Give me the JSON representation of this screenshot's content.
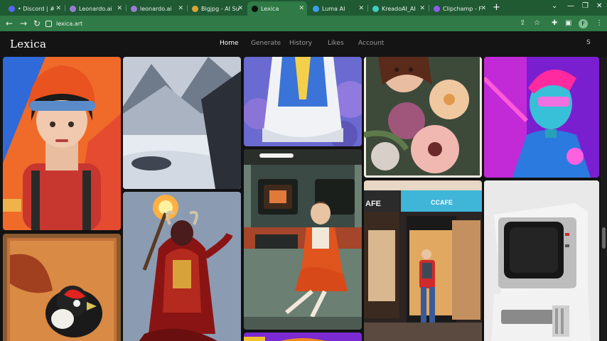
{
  "browser": {
    "tabs": [
      {
        "title": "• Discord | #",
        "favicon_color": "#5865f2"
      },
      {
        "title": "Leonardo.ai",
        "favicon_color": "#9b7bd6"
      },
      {
        "title": "leonardo.ai",
        "favicon_color": "#9b7bd6"
      },
      {
        "title": "Bigjpg - AI Su",
        "favicon_color": "#d8a53a"
      },
      {
        "title": "Lexica",
        "favicon_color": "#111111"
      },
      {
        "title": "Luma AI",
        "favicon_color": "#3aa0e8"
      },
      {
        "title": "KreadoAI_AI",
        "favicon_color": "#3fd0c0"
      },
      {
        "title": "Clipchamp - F",
        "favicon_color": "#8e5cf0"
      }
    ],
    "active_tab": 4,
    "new_tab_label": "+",
    "url": "lexica.art",
    "profile_initial": "F",
    "icons": [
      "back-icon",
      "forward-icon",
      "reload-icon",
      "share-icon",
      "star-icon",
      "extensions-icon",
      "sidebar-icon",
      "menu-icon"
    ],
    "window_controls": [
      "minimize-icon",
      "maximize-icon",
      "close-icon",
      "tab-search-icon"
    ]
  },
  "site": {
    "logo": "Lexica",
    "nav": [
      {
        "label": "Home",
        "active": true
      },
      {
        "label": "Generate",
        "active": false
      },
      {
        "label": "History",
        "active": false
      },
      {
        "label": "Likes",
        "active": false
      },
      {
        "label": "Account",
        "active": false
      }
    ],
    "user_initial": "S"
  },
  "gallery": {
    "images": [
      {
        "name": "firefighter-girl-helmet"
      },
      {
        "name": "snowy-mountain-landscape"
      },
      {
        "name": "princess-blue-dress"
      },
      {
        "name": "woman-with-flowers"
      },
      {
        "name": "neon-cyberpunk-man"
      },
      {
        "name": "red-demon-warrior-torch"
      },
      {
        "name": "retro-woman-computer"
      },
      {
        "name": "cafe-storefront",
        "signs": [
          "AFE",
          "CCAFE"
        ]
      },
      {
        "name": "retro-white-computer"
      },
      {
        "name": "red-headed-bird"
      },
      {
        "name": "abstract-orange-shapes"
      }
    ]
  },
  "colors": {
    "chrome_dark": "#1f5a33",
    "chrome": "#2f7a46",
    "site_bg": "#111111"
  }
}
